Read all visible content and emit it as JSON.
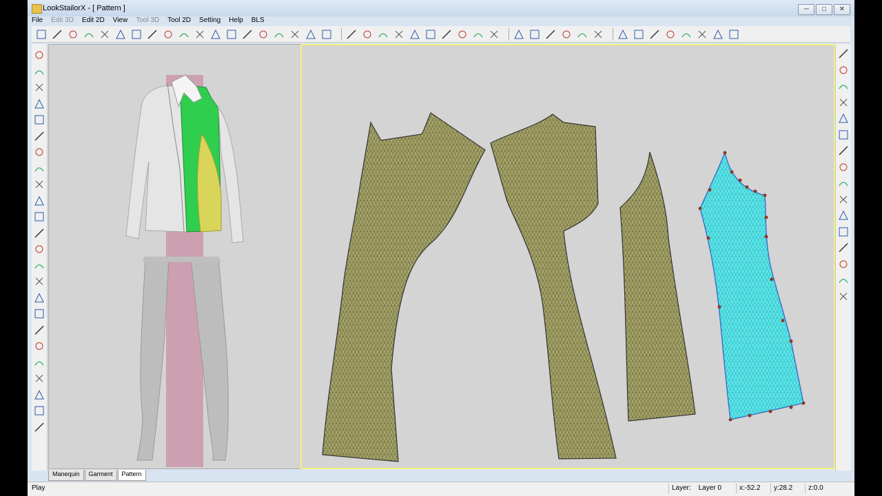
{
  "window": {
    "title": "LookStailorX - [ Pattern ]",
    "controls": [
      "─",
      "□",
      "✕"
    ]
  },
  "menu": [
    "File",
    "Edit 3D",
    "Edit 2D",
    "View",
    "Tool 3D",
    "Tool 2D",
    "Setting",
    "Help",
    "BLS"
  ],
  "menu_disabled": [
    "Edit 3D",
    "Tool 3D"
  ],
  "toolbar_icons": [
    "new-icon",
    "open-icon",
    "save-icon",
    "save-as-icon",
    "undo-icon",
    "redo-icon",
    "view-icon",
    "pan-icon",
    "zoom-icon",
    "rotate-icon",
    "hand-icon",
    "render-icon",
    "texture-icon",
    "mesh-icon",
    "move-icon",
    "grid-icon",
    "import-icon",
    "export-icon",
    "save-all-icon",
    "line-icon",
    "curve-icon",
    "pen-icon",
    "point-icon",
    "bezier-icon",
    "arc-icon",
    "notch-icon",
    "eraser-icon",
    "measure-icon",
    "ruler-icon",
    "align-icon",
    "distribute-icon",
    "mirror-icon",
    "triangle-icon",
    "triangle-icon",
    "tape-icon",
    "color-icon",
    "palette-icon",
    "grid-color-icon",
    "garment-icon",
    "shirt-icon",
    "coat-icon",
    "pants-icon",
    "dress-icon"
  ],
  "tabs": [
    {
      "label": "Manequin",
      "active": false
    },
    {
      "label": "Garment",
      "active": false
    },
    {
      "label": "Pattern",
      "active": true
    }
  ],
  "status": {
    "left": "Play",
    "layer_label": "Layer:",
    "layer_value": "Layer 0",
    "x": "x:-52.2",
    "y": "y:28.2",
    "z": "z:0.0"
  },
  "colors": {
    "pattern_fill": "#a6a46a",
    "selected_fill": "#5ce7ea",
    "viewport_bg": "#d4d4d4",
    "active_border": "#f5f07a",
    "garment_green": "#2fce4f",
    "garment_yellow": "#d8d55a",
    "plane_pink": "#c98fa5"
  }
}
